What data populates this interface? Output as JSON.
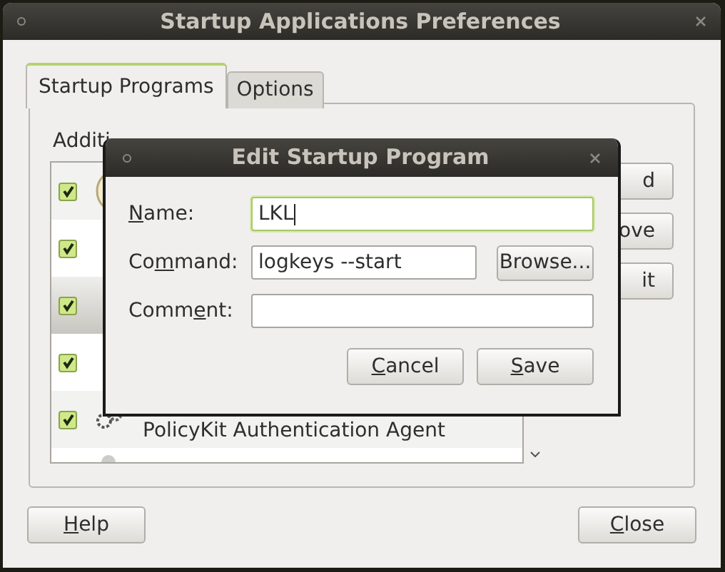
{
  "window": {
    "title": "Startup Applications Preferences"
  },
  "tabs": [
    {
      "label": "Startup Programs",
      "selected": true
    },
    {
      "label": "Options",
      "selected": false
    }
  ],
  "list_label": "Additi",
  "programs": [
    {
      "checked": true,
      "selected": false
    },
    {
      "checked": true,
      "selected": false
    },
    {
      "checked": true,
      "selected": true
    },
    {
      "checked": true,
      "selected": false
    },
    {
      "checked": true,
      "selected": false,
      "name": "PolicyKit Authentication Agent"
    },
    {
      "selected": false
    }
  ],
  "side_buttons": [
    {
      "label": "d"
    },
    {
      "label": "ove"
    },
    {
      "label": "it"
    }
  ],
  "dialog": {
    "title": "Edit Startup Program",
    "fields": [
      {
        "label": {
          "key": "N",
          "after": "ame:"
        },
        "value": "LKL",
        "focused": true
      },
      {
        "label": {
          "before": "Co",
          "key": "m",
          "after": "mand:"
        },
        "value": "logkeys --start",
        "focused": false,
        "button": "Browse..."
      },
      {
        "label": {
          "before": "Comm",
          "key": "e",
          "after": "nt:"
        },
        "focused": false
      }
    ],
    "buttons": [
      {
        "label": {
          "key": "C",
          "after": "ancel"
        }
      },
      {
        "label": {
          "key": "S",
          "after": "ave"
        }
      }
    ]
  },
  "buttons": [
    {
      "label": {
        "key": "H",
        "after": "elp"
      }
    },
    {
      "label": {
        "key": "C",
        "after": "lose"
      }
    }
  ]
}
